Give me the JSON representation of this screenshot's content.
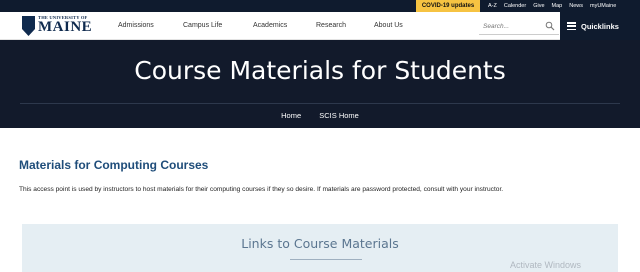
{
  "utility": {
    "covid_label": "COVID-19 updates",
    "links": [
      "A-Z",
      "Calender",
      "Give",
      "Map",
      "News",
      "myUMaine"
    ]
  },
  "logo": {
    "small_text": "THE UNIVERSITY OF",
    "big_text": "MAINE"
  },
  "nav": {
    "items": [
      "Admissions",
      "Campus Life",
      "Academics",
      "Research",
      "About Us"
    ],
    "search_placeholder": "Search...",
    "quicklinks_label": "Quicklinks"
  },
  "hero": {
    "title": "Course Materials for Students",
    "breadcrumb": [
      "Home",
      "SCIS Home"
    ]
  },
  "main": {
    "heading": "Materials for Computing Courses",
    "intro": "This access point is used by instructors to host materials for their computing courses if they so desire. If materials are password protected, consult with your instructor.",
    "panel_heading": "Links to Course Materials"
  },
  "overlay": {
    "watermark": "Activate Windows"
  },
  "colors": {
    "dark_navy": "#0f1b2e",
    "hero_bg": "#121a2b",
    "covid_yellow": "#f6c342",
    "heading_blue": "#1f4d7a",
    "panel_bg": "#e5eef3"
  }
}
